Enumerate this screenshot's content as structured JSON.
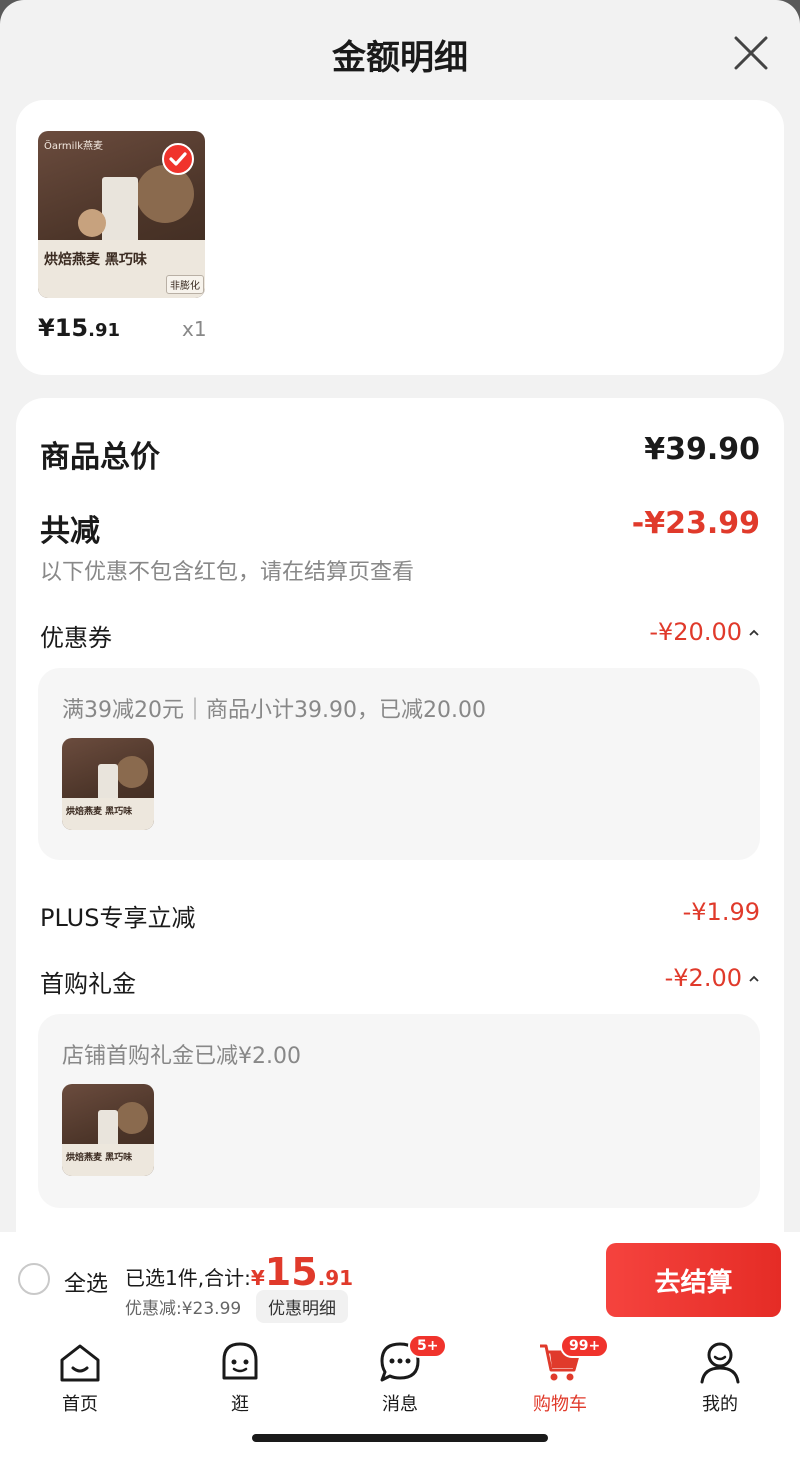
{
  "sheet": {
    "title": "金额明细"
  },
  "product": {
    "thumb_brand": "Öarmilk燕麦",
    "thumb_title": "烘焙燕麦 黑巧味",
    "thumb_tag": "非膨化",
    "price_int": "¥15",
    "price_dec": ".91",
    "qty": "x1"
  },
  "summary": {
    "total_label": "商品总价",
    "total_value": "¥39.90",
    "reduce_label": "共减",
    "reduce_value": "-¥23.99",
    "note": "以下优惠不包含红包，请在结算页查看"
  },
  "coupon": {
    "label": "优惠券",
    "value": "-¥20.00",
    "detail": "满39减20元｜商品小计39.90，已减20.00"
  },
  "plus": {
    "label": "PLUS专享立减",
    "value": "-¥1.99"
  },
  "first_gift": {
    "label": "首购礼金",
    "value": "-¥2.00",
    "detail": "店铺首购礼金已减¥2.00"
  },
  "bottom": {
    "select_all": "全选",
    "selected_text": "已选1件,合计:",
    "total_yen": "¥",
    "total_int": "15",
    "total_dec": ".91",
    "discount_text": "优惠减:¥23.99",
    "detail_chip": "优惠明细",
    "checkout": "去结算"
  },
  "tabs": [
    {
      "label": "首页",
      "icon": "home-icon"
    },
    {
      "label": "逛",
      "icon": "stroll-icon"
    },
    {
      "label": "消息",
      "icon": "message-icon",
      "badge": "5+"
    },
    {
      "label": "购物车",
      "icon": "cart-icon",
      "badge": "99+",
      "active": true
    },
    {
      "label": "我的",
      "icon": "profile-icon"
    }
  ],
  "colors": {
    "accent": "#e03a2b",
    "checkout": "#f5433e"
  }
}
